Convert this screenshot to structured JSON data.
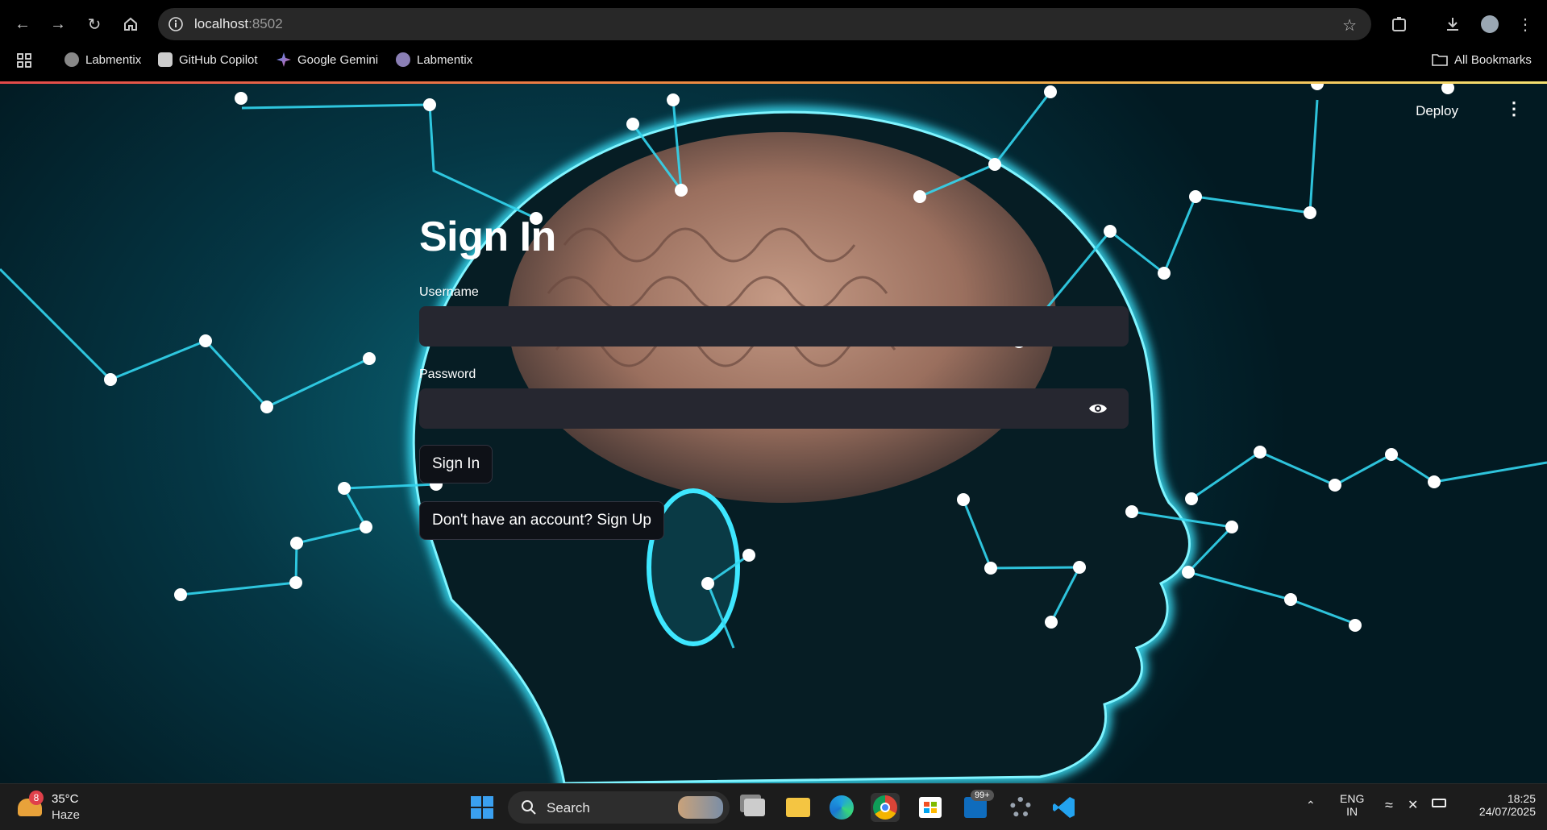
{
  "browser": {
    "url_host": "localhost",
    "url_port": ":8502",
    "bookmarks": [
      "Labmentix",
      "GitHub Copilot",
      "Google Gemini",
      "Labmentix"
    ],
    "all_bookmarks": "All Bookmarks"
  },
  "app": {
    "deploy_label": "Deploy",
    "title": "Sign In",
    "username_label": "Username",
    "username_value": "",
    "password_label": "Password",
    "password_value": "",
    "signin_button": "Sign In",
    "signup_button": "Don't have an account? Sign Up"
  },
  "taskbar": {
    "weather_badge": "8",
    "temperature": "35°C",
    "condition": "Haze",
    "search_label": "Search",
    "outlook_badge": "99+",
    "lang_line1": "ENG",
    "lang_line2": "IN",
    "time": "18:25",
    "date": "24/07/2025"
  },
  "colors": {
    "input_bg": "#262730",
    "button_bg": "#0e1117",
    "neon": "#22d3ee"
  }
}
